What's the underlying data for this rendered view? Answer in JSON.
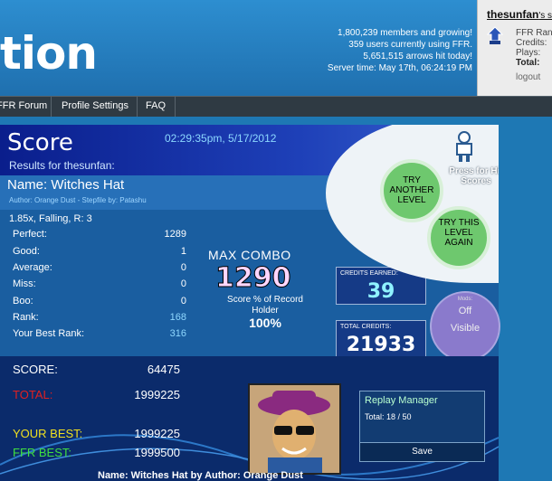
{
  "header": {
    "logo_text": "tion",
    "stats": [
      "1,800,239 members and growing!",
      "359 users currently using FFR.",
      "5,651,515 arrows hit today!",
      "Server time: May 17th, 06:24:19 PM"
    ]
  },
  "user": {
    "name": "thesunfan",
    "suffix": "'s st",
    "labels": [
      "FFR Ran",
      "Credits:",
      "Plays:",
      "Total:"
    ],
    "logout": "logout"
  },
  "nav": {
    "items": [
      "FFR Forum",
      "Profile Settings",
      "FAQ"
    ]
  },
  "score": {
    "title": "Score",
    "timestamp": "02:29:35pm, 5/17/2012",
    "results_for": "Results for thesunfan:",
    "song_name": "Name: Witches Hat",
    "author_line": "Author: Orange Dust   -   Stepfile by: Patashu",
    "mods": "1.85x, Falling, R: 3",
    "judgements": [
      {
        "label": "Perfect:",
        "value": "1289"
      },
      {
        "label": "Good:",
        "value": "1"
      },
      {
        "label": "Average:",
        "value": "0"
      },
      {
        "label": "Miss:",
        "value": "0"
      },
      {
        "label": "Boo:",
        "value": "0"
      },
      {
        "label": "Rank:",
        "value": "168"
      },
      {
        "label": "Your Best Rank:",
        "value": "316"
      }
    ],
    "max_combo_label": "MAX COMBO",
    "max_combo": "1290",
    "pct_label": "Score % of Record Holder",
    "pct_value": "100%",
    "credits_earned_label": "CREDITS EARNED:",
    "credits_earned": "39",
    "total_credits_label": "TOTAL CREDITS:",
    "total_credits": "21933",
    "try_another": "TRY ANOTHER LEVEL",
    "try_again": "TRY THIS LEVEL AGAIN",
    "press_hiscores": "Press for Hi-Scores",
    "mods_circle": {
      "title": "Mods:",
      "off": "Off",
      "visible": "Visible"
    },
    "score_label": "SCORE:",
    "score_value": "64475",
    "total_label": "TOTAL:",
    "total_value": "1999225",
    "your_best_label": "YOUR BEST:",
    "your_best_value": "1999225",
    "ffr_best_label": "FFR BEST:",
    "ffr_best_value": "1999500",
    "replay_title": "Replay Manager",
    "replay_count": "Total: 18 / 50",
    "save_label": "Save",
    "footer": "Name: Witches Hat by Author: Orange Dust"
  },
  "colors": {
    "score_label": "#ffffff",
    "total_label": "#e02020",
    "your_best": "#f0e020",
    "ffr_best": "#40e040"
  }
}
